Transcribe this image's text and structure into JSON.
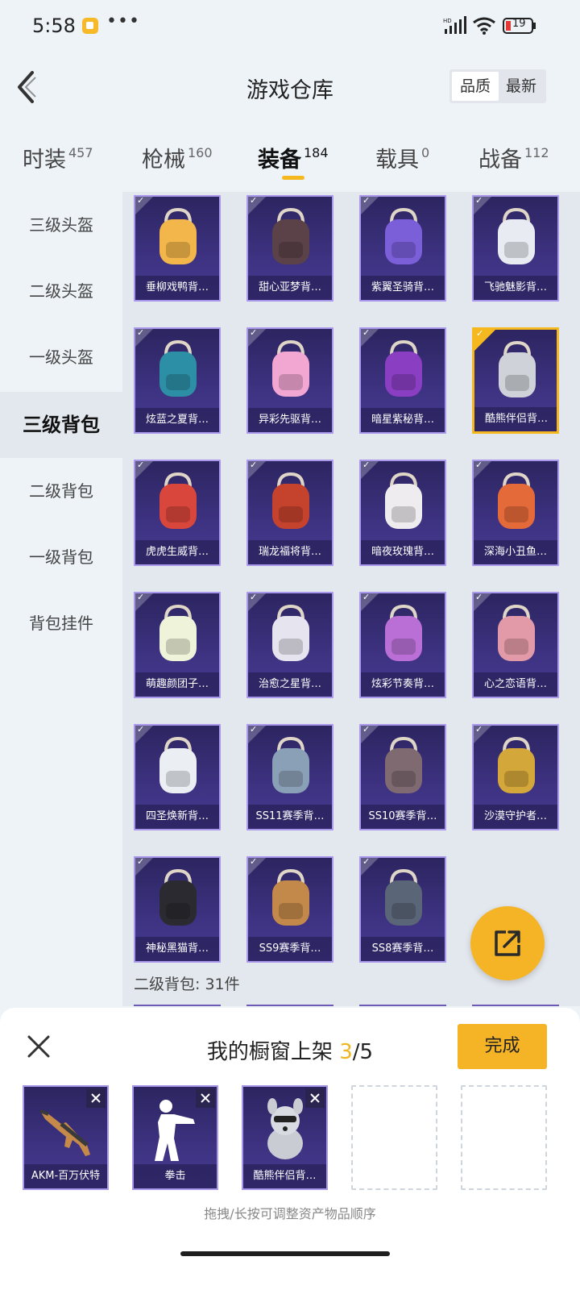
{
  "status_bar": {
    "time": "5:58",
    "dots": "•••",
    "battery": "19",
    "network": "HD"
  },
  "header": {
    "title": "游戏仓库",
    "sort_quality": "品质",
    "sort_newest": "最新"
  },
  "tabs": [
    {
      "label": "时装",
      "count": "457"
    },
    {
      "label": "枪械",
      "count": "160"
    },
    {
      "label": "装备",
      "count": "184"
    },
    {
      "label": "载具",
      "count": "0"
    },
    {
      "label": "战备",
      "count": "112"
    }
  ],
  "sidebar": {
    "items": [
      {
        "label": "三级头盔"
      },
      {
        "label": "二级头盔"
      },
      {
        "label": "一级头盔"
      },
      {
        "label": "三级背包"
      },
      {
        "label": "二级背包"
      },
      {
        "label": "一级背包"
      },
      {
        "label": "背包挂件"
      }
    ]
  },
  "grid": {
    "items": [
      {
        "label": "垂柳戏鸭背…",
        "color": "#f2b64a"
      },
      {
        "label": "甜心亚梦背…",
        "color": "#5b4248"
      },
      {
        "label": "紫翼圣骑背…",
        "color": "#7b5fd9"
      },
      {
        "label": "飞驰魅影背…",
        "color": "#e8ecf2"
      },
      {
        "label": "炫蓝之夏背…",
        "color": "#2d8fa6"
      },
      {
        "label": "异彩先驱背…",
        "color": "#f1a7d2"
      },
      {
        "label": "暗星紫秘背…",
        "color": "#8a3fc2"
      },
      {
        "label": "酷熊伴侣背…",
        "color": "#cfd2d8"
      },
      {
        "label": "虎虎生威背…",
        "color": "#d9463b"
      },
      {
        "label": "瑞龙福将背…",
        "color": "#c5432d"
      },
      {
        "label": "暗夜玫瑰背…",
        "color": "#efecef"
      },
      {
        "label": "深海小丑鱼…",
        "color": "#e46a3a"
      },
      {
        "label": "萌趣颜团子…",
        "color": "#eef3d9"
      },
      {
        "label": "治愈之星背…",
        "color": "#e6e4ee"
      },
      {
        "label": "炫彩节奏背…",
        "color": "#b96fd6"
      },
      {
        "label": "心之恋语背…",
        "color": "#e39aa8"
      },
      {
        "label": "四圣焕新背…",
        "color": "#ebeef3"
      },
      {
        "label": "SS11赛季背…",
        "color": "#8aa0b6"
      },
      {
        "label": "SS10赛季背…",
        "color": "#7f6a72"
      },
      {
        "label": "沙漠守护者…",
        "color": "#d4a73a"
      },
      {
        "label": "神秘黑猫背…",
        "color": "#2a2a30"
      },
      {
        "label": "SS9赛季背…",
        "color": "#c2894a"
      },
      {
        "label": "SS8赛季背…",
        "color": "#5a6678"
      }
    ],
    "selected_index": 7
  },
  "section": {
    "label": "二级背包: 31件"
  },
  "sheet": {
    "title": "我的橱窗上架",
    "count_current": "3",
    "count_total": "/5",
    "done_label": "完成",
    "slots": [
      {
        "label": "AKM-百万伏特"
      },
      {
        "label": "拳击"
      },
      {
        "label": "酷熊伴侣背…"
      }
    ],
    "hint": "拖拽/长按可调整资产物品顺序"
  },
  "colors": {
    "accent": "#f5b425",
    "card_bg": "#3e3282",
    "card_border": "#a998ea"
  }
}
